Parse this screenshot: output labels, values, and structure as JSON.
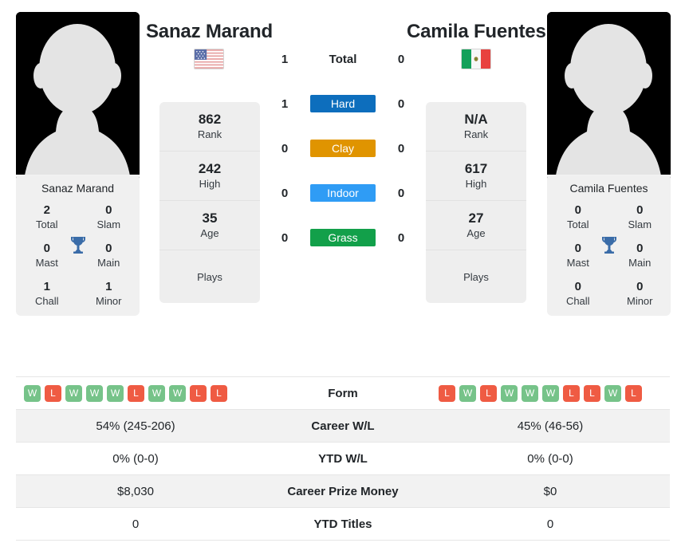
{
  "players": {
    "left": {
      "name": "Sanaz Marand",
      "flag": "us-flag-icon",
      "rank": "862",
      "rank_label": "Rank",
      "high": "242",
      "high_label": "High",
      "age": "35",
      "age_label": "Age",
      "plays": "",
      "plays_label": "Plays",
      "titles": {
        "total": "2",
        "total_label": "Total",
        "slam": "0",
        "slam_label": "Slam",
        "mast": "0",
        "mast_label": "Mast",
        "main": "0",
        "main_label": "Main",
        "chall": "1",
        "chall_label": "Chall",
        "minor": "1",
        "minor_label": "Minor"
      },
      "form": [
        "W",
        "L",
        "W",
        "W",
        "W",
        "L",
        "W",
        "W",
        "L",
        "L"
      ],
      "career_wl": "54% (245-206)",
      "ytd_wl": "0% (0-0)",
      "prize_money": "$8,030",
      "ytd_titles": "0"
    },
    "right": {
      "name": "Camila Fuentes",
      "flag": "mx-flag-icon",
      "rank": "N/A",
      "rank_label": "Rank",
      "high": "617",
      "high_label": "High",
      "age": "27",
      "age_label": "Age",
      "plays": "",
      "plays_label": "Plays",
      "titles": {
        "total": "0",
        "total_label": "Total",
        "slam": "0",
        "slam_label": "Slam",
        "mast": "0",
        "mast_label": "Mast",
        "main": "0",
        "main_label": "Main",
        "chall": "0",
        "chall_label": "Chall",
        "minor": "0",
        "minor_label": "Minor"
      },
      "form": [
        "L",
        "W",
        "L",
        "W",
        "W",
        "W",
        "L",
        "L",
        "W",
        "L"
      ],
      "career_wl": "45% (46-56)",
      "ytd_wl": "0% (0-0)",
      "prize_money": "$0",
      "ytd_titles": "0"
    }
  },
  "head_to_head": [
    {
      "label": "Total",
      "left": "1",
      "right": "0",
      "badge": false,
      "color": ""
    },
    {
      "label": "Hard",
      "left": "1",
      "right": "0",
      "badge": true,
      "color": "#0d6ebd"
    },
    {
      "label": "Clay",
      "left": "0",
      "right": "0",
      "badge": true,
      "color": "#e09400"
    },
    {
      "label": "Indoor",
      "left": "0",
      "right": "0",
      "badge": true,
      "color": "#2f9cf5"
    },
    {
      "label": "Grass",
      "left": "0",
      "right": "0",
      "badge": true,
      "color": "#12a04a"
    }
  ],
  "table_rows": [
    {
      "label": "Form",
      "left": "",
      "right": "",
      "form": true
    },
    {
      "label": "Career W/L",
      "left": "54% (245-206)",
      "right": "45% (46-56)",
      "form": false
    },
    {
      "label": "YTD W/L",
      "left": "0% (0-0)",
      "right": "0% (0-0)",
      "form": false
    },
    {
      "label": "Career Prize Money",
      "left": "$8,030",
      "right": "$0",
      "form": false
    },
    {
      "label": "YTD Titles",
      "left": "0",
      "right": "0",
      "form": false
    }
  ],
  "colors": {
    "hard": "#0d6ebd",
    "clay": "#e09400",
    "indoor": "#2f9cf5",
    "grass": "#12a04a",
    "win": "#76c389",
    "loss": "#ef5b43",
    "trophy": "#3a6ca8"
  }
}
